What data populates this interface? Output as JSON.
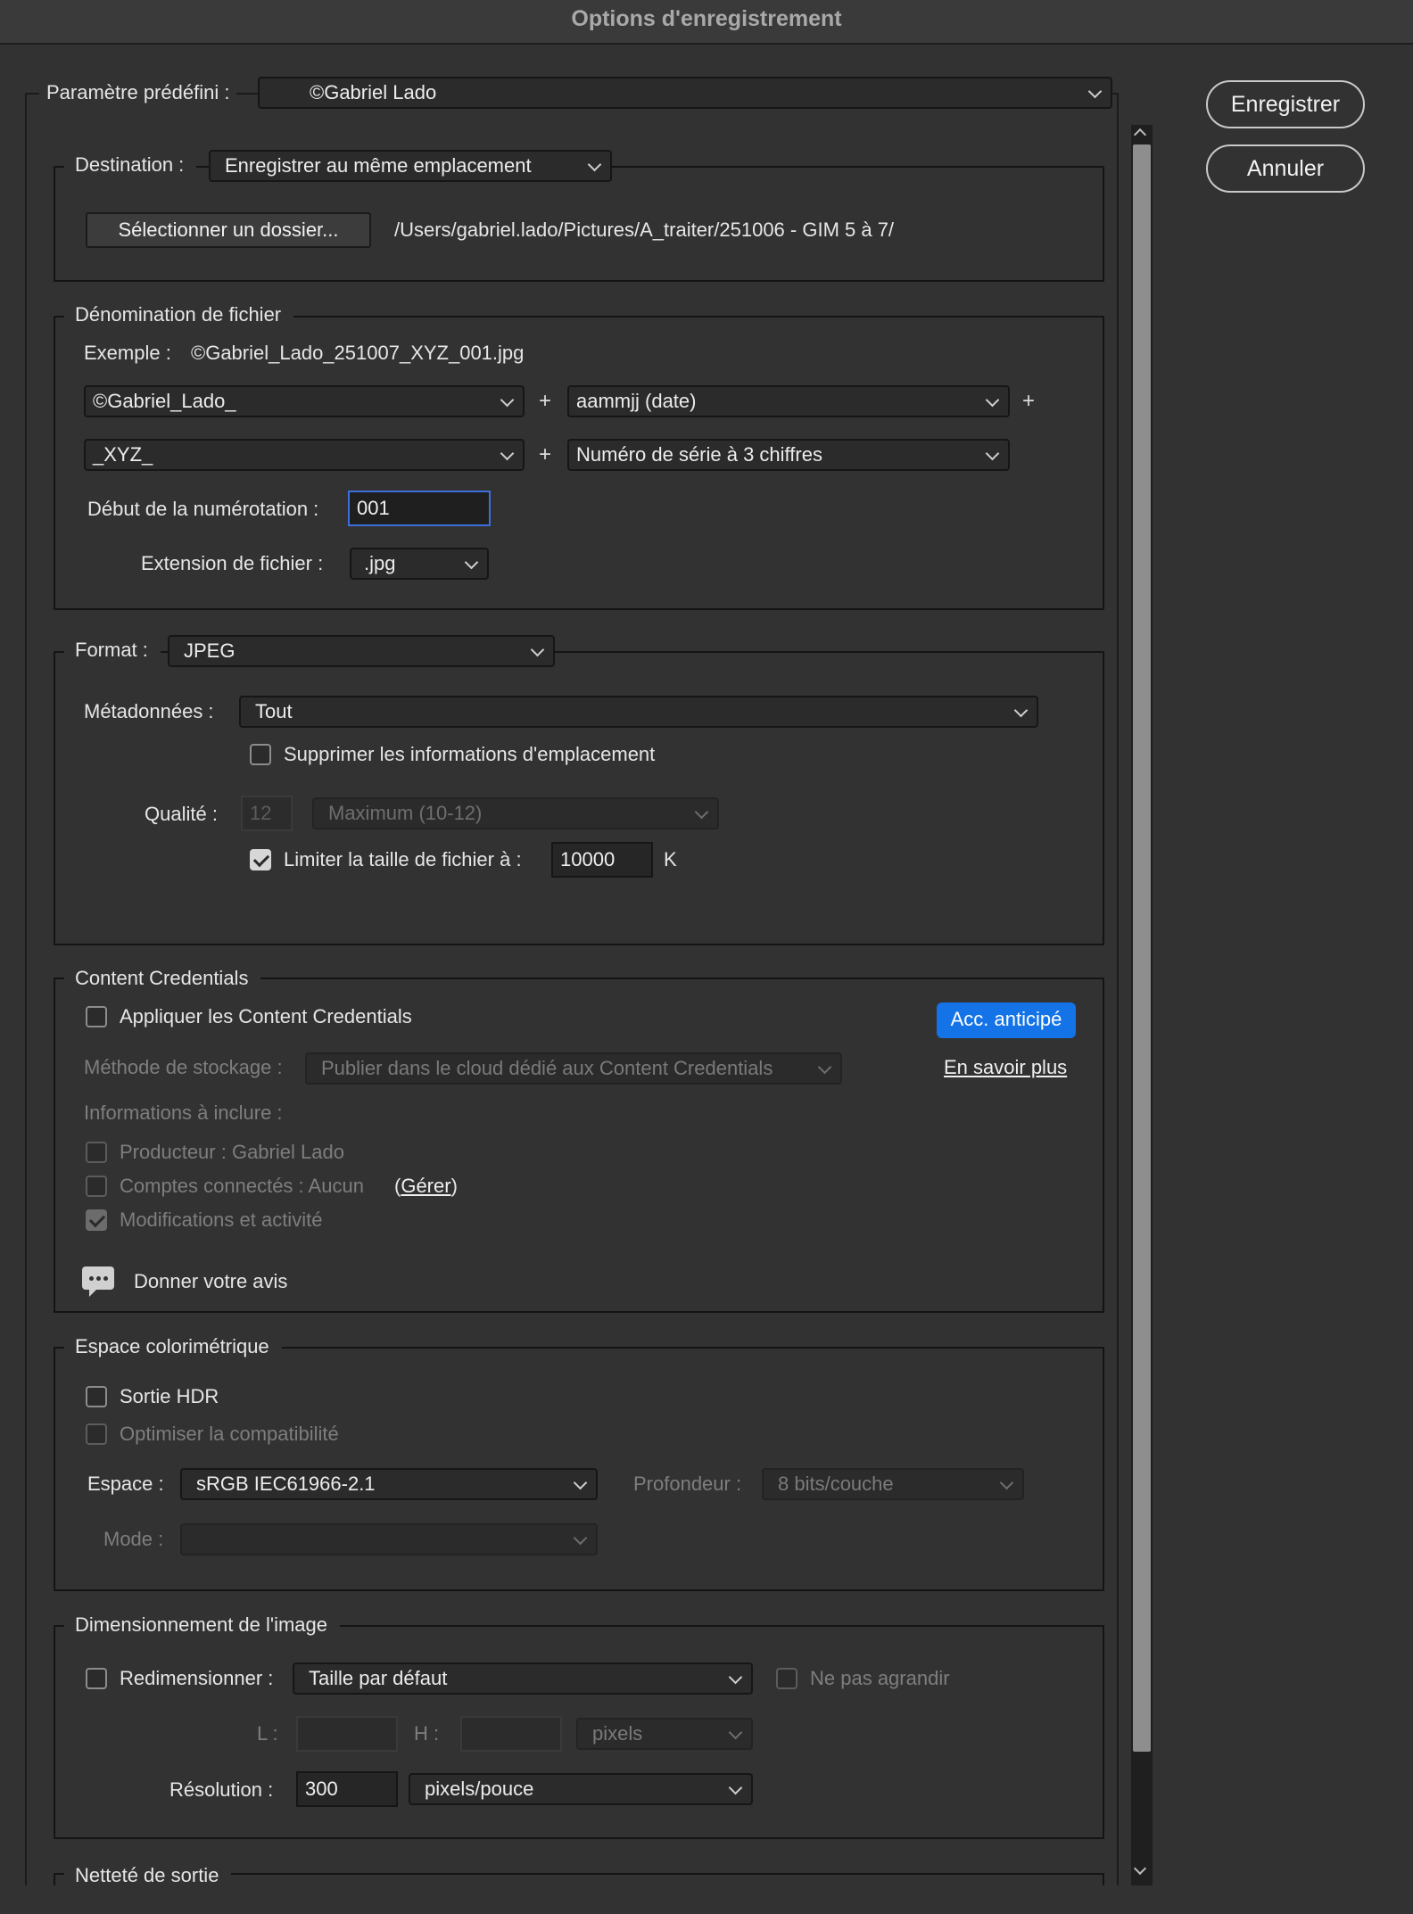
{
  "window": {
    "title": "Options d'enregistrement"
  },
  "actions": {
    "save": "Enregistrer",
    "cancel": "Annuler"
  },
  "preset": {
    "label": "Paramètre prédéfini :",
    "value": "©Gabriel Lado"
  },
  "destination": {
    "label": "Destination :",
    "value": "Enregistrer au même emplacement",
    "choose_folder": "Sélectionner un dossier...",
    "path": "/Users/gabriel.lado/Pictures/A_traiter/251006 - GIM 5 à 7/"
  },
  "naming": {
    "legend": "Dénomination de fichier",
    "example_label": "Exemple :",
    "example_value": "©Gabriel_Lado_251007_XYZ_001.jpg",
    "part1": "©Gabriel_Lado_",
    "part2": "aammjj (date)",
    "part3": "_XYZ_",
    "part4": "Numéro de série à 3 chiffres",
    "plus": "+",
    "start_label": "Début de la numérotation :",
    "start_value": "001",
    "ext_label": "Extension de fichier :",
    "ext_value": ".jpg"
  },
  "format": {
    "label": "Format :",
    "value": "JPEG",
    "metadata_label": "Métadonnées :",
    "metadata_value": "Tout",
    "remove_location": "Supprimer les informations d'emplacement",
    "quality_label": "Qualité :",
    "quality_value": "12",
    "quality_preset": "Maximum  (10-12)",
    "limit_label": "Limiter la taille de fichier à :",
    "limit_value": "10000",
    "limit_unit": "K"
  },
  "credentials": {
    "legend": "Content Credentials",
    "apply": "Appliquer les Content Credentials",
    "badge": "Acc. anticipé",
    "storage_label": "Méthode de stockage :",
    "storage_value": "Publier dans le cloud dédié aux Content Credentials",
    "learn_more": "En savoir plus",
    "include_label": "Informations à inclure :",
    "producer": "Producteur : Gabriel Lado",
    "accounts": "Comptes connectés : Aucun",
    "manage_open": "(",
    "manage": "Gérer",
    "manage_close": ")",
    "edits": "Modifications et activité",
    "feedback": "Donner votre avis"
  },
  "color": {
    "legend": "Espace colorimétrique",
    "hdr": "Sortie HDR",
    "compat": "Optimiser la compatibilité",
    "space_label": "Espace :",
    "space_value": "sRGB IEC61966-2.1",
    "depth_label": "Profondeur :",
    "depth_value": "8 bits/couche",
    "mode_label": "Mode :",
    "mode_value": ""
  },
  "sizing": {
    "legend": "Dimensionnement de l'image",
    "resize": "Redimensionner :",
    "resize_value": "Taille par défaut",
    "no_enlarge": "Ne pas agrandir",
    "w_label": "L :",
    "h_label": "H :",
    "unit": "pixels",
    "res_label": "Résolution :",
    "res_value": "300",
    "res_unit": "pixels/pouce"
  },
  "sharpen": {
    "legend": "Netteté de sortie"
  }
}
